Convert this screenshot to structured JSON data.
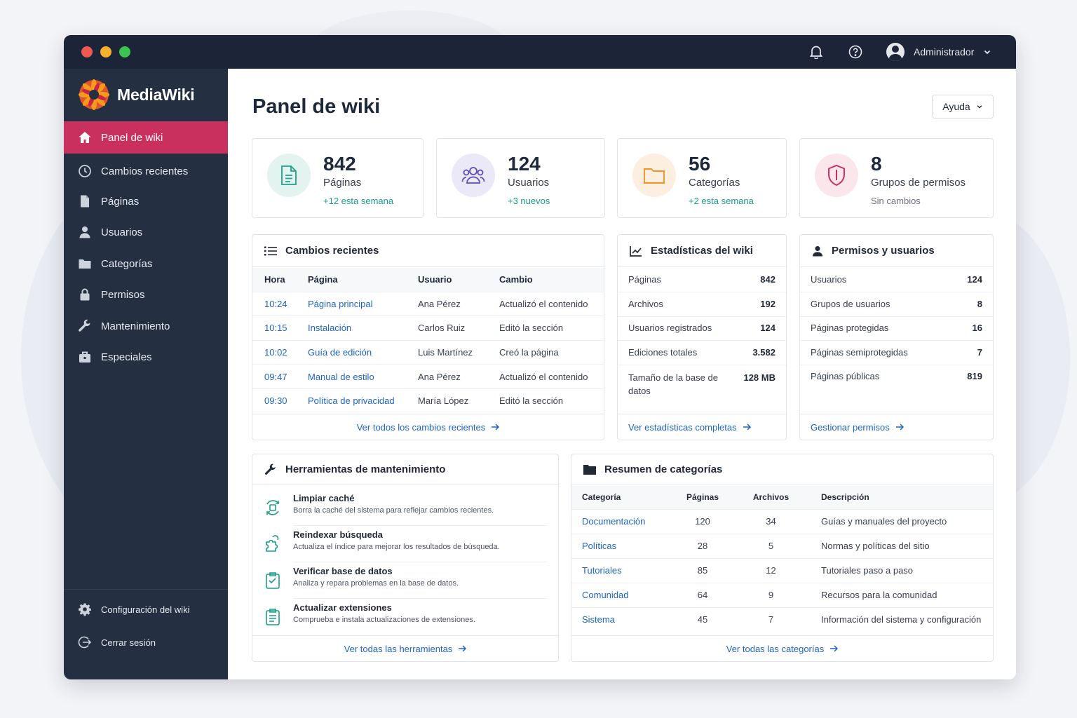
{
  "topbar": {
    "user_name": "Administrador",
    "icons": [
      "bell-icon",
      "help-icon",
      "user-avatar",
      "chevron-down-icon"
    ]
  },
  "sidebar": {
    "logo_text": "MediaWiki",
    "items": [
      {
        "label": "Panel de wiki",
        "icon": "home-icon",
        "active": true
      },
      {
        "label": "Cambios recientes",
        "icon": "clock-icon"
      },
      {
        "label": "Páginas",
        "icon": "page-icon"
      },
      {
        "label": "Usuarios",
        "icon": "user-icon"
      },
      {
        "label": "Categorías",
        "icon": "folder-icon"
      },
      {
        "label": "Permisos",
        "icon": "lock-icon"
      },
      {
        "label": "Mantenimiento",
        "icon": "wrench-icon"
      },
      {
        "label": "Especiales",
        "icon": "briefcase-icon"
      }
    ],
    "bottom": [
      {
        "label": "Configuración del wiki",
        "icon": "gear-icon"
      },
      {
        "label": "Cerrar sesión",
        "icon": "logout-icon"
      }
    ]
  },
  "header": {
    "title": "Panel de wiki",
    "help_label": "Ayuda"
  },
  "stats": [
    {
      "value": "842",
      "label": "Páginas",
      "sub": "+12 esta semana"
    },
    {
      "value": "124",
      "label": "Usuarios",
      "sub": "+3 nuevos"
    },
    {
      "value": "56",
      "label": "Categorías",
      "sub": "+2 esta semana"
    },
    {
      "value": "8",
      "label": "Grupos de permisos",
      "sub": "Sin cambios"
    }
  ],
  "recent": {
    "title": "Cambios recientes",
    "columns": [
      "Hora",
      "Página",
      "Usuario",
      "Cambio"
    ],
    "rows": [
      [
        "10:24",
        "Página principal",
        "Ana Pérez",
        "Actualizó el contenido"
      ],
      [
        "10:15",
        "Instalación",
        "Carlos Ruiz",
        "Editó la sección"
      ],
      [
        "10:02",
        "Guía de edición",
        "Luis Martínez",
        "Creó la página"
      ],
      [
        "09:47",
        "Manual de estilo",
        "Ana Pérez",
        "Actualizó el contenido"
      ],
      [
        "09:30",
        "Política de privacidad",
        "María López",
        "Editó la sección"
      ]
    ],
    "footer": "Ver todos los cambios recientes"
  },
  "wikistats": {
    "title": "Estadísticas del wiki",
    "rows": [
      {
        "label": "Páginas",
        "value": "842"
      },
      {
        "label": "Archivos",
        "value": "192"
      },
      {
        "label": "Usuarios registrados",
        "value": "124"
      },
      {
        "label": "Ediciones totales",
        "value": "3.582"
      },
      {
        "label": "Tamaño de la base de datos",
        "value": "128 MB"
      }
    ],
    "footer": "Ver estadísticas completas"
  },
  "perms": {
    "title": "Permisos y usuarios",
    "rows": [
      {
        "label": "Usuarios",
        "value": "124"
      },
      {
        "label": "Grupos de usuarios",
        "value": "8"
      },
      {
        "label": "Páginas protegidas",
        "value": "16"
      },
      {
        "label": "Páginas semiprotegidas",
        "value": "7"
      },
      {
        "label": "Páginas públicas",
        "value": "819"
      }
    ],
    "footer": "Gestionar permisos"
  },
  "tools": {
    "title": "Herramientas de mantenimiento",
    "items": [
      {
        "title": "Limpiar caché",
        "desc": "Borra la caché del sistema para reflejar cambios recientes."
      },
      {
        "title": "Reindexar búsqueda",
        "desc": "Actualiza el índice para mejorar los resultados de búsqueda."
      },
      {
        "title": "Verificar base de datos",
        "desc": "Analiza y repara problemas en la base de datos."
      },
      {
        "title": "Actualizar extensiones",
        "desc": "Comprueba e instala actualizaciones de extensiones."
      }
    ],
    "footer": "Ver todas las herramientas"
  },
  "categories": {
    "title": "Resumen de categorías",
    "columns": [
      "Categoría",
      "Páginas",
      "Archivos",
      "Descripción"
    ],
    "rows": [
      [
        "Documentación",
        "120",
        "34",
        "Guías y manuales del proyecto"
      ],
      [
        "Políticas",
        "28",
        "5",
        "Normas y políticas del sitio"
      ],
      [
        "Tutoriales",
        "85",
        "12",
        "Tutoriales paso a paso"
      ],
      [
        "Comunidad",
        "64",
        "9",
        "Recursos para la comunidad"
      ],
      [
        "Sistema",
        "45",
        "7",
        "Información del sistema y configuración"
      ]
    ],
    "footer": "Ver todas las categorías"
  },
  "colors": {
    "accent": "#c9305e",
    "sidebar_bg": "#243041",
    "topbar_bg": "#1b2537",
    "link": "#1d64c4",
    "positive": "#199d8a"
  }
}
